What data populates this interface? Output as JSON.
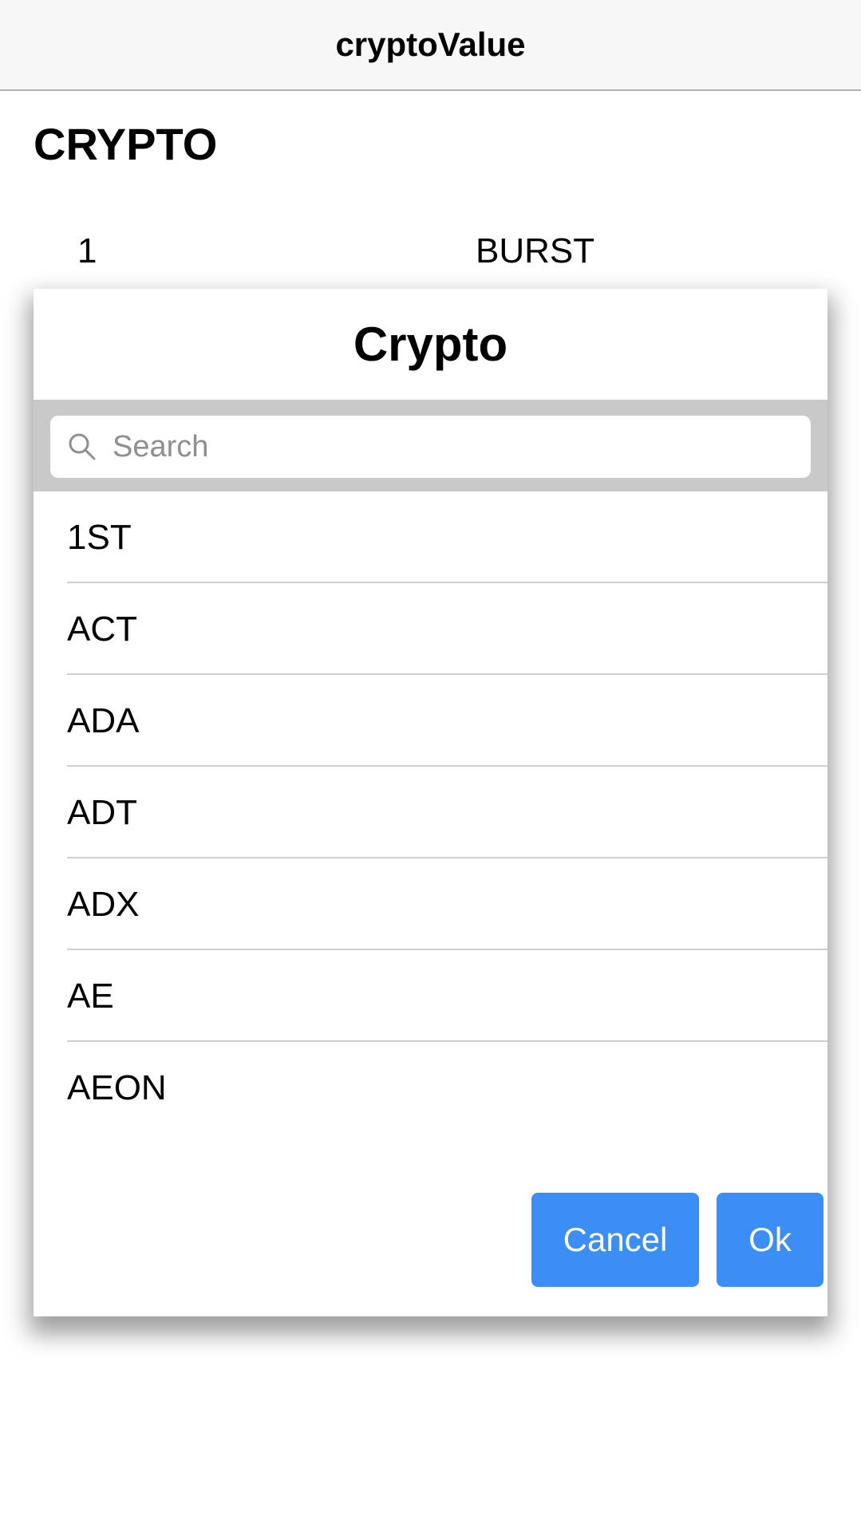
{
  "nav": {
    "title": "cryptoValue"
  },
  "section": {
    "title": "CRYPTO"
  },
  "row": {
    "number": "1",
    "symbol": "BURST"
  },
  "dialog": {
    "title": "Crypto",
    "search": {
      "placeholder": "Search",
      "value": "",
      "icon": "search-icon"
    },
    "items": [
      {
        "label": "1ST"
      },
      {
        "label": "ACT"
      },
      {
        "label": "ADA"
      },
      {
        "label": "ADT"
      },
      {
        "label": "ADX"
      },
      {
        "label": "AE"
      },
      {
        "label": "AEON"
      }
    ],
    "actions": {
      "cancel_label": "Cancel",
      "ok_label": "Ok"
    }
  },
  "colors": {
    "accent": "#3b8ef5",
    "search_bar_bg": "#c9c9c9",
    "nav_bg": "#f7f7f7"
  }
}
